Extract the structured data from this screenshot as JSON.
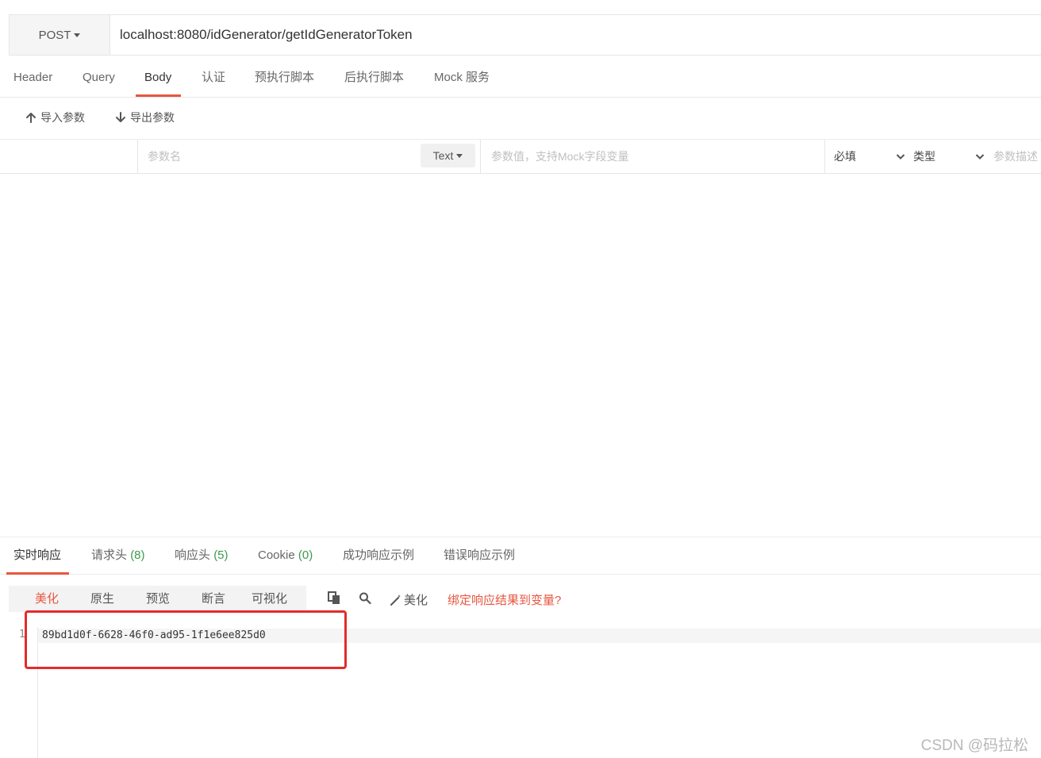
{
  "request": {
    "method": "POST",
    "url": "localhost:8080/idGenerator/getIdGeneratorToken"
  },
  "request_tabs": [
    "Header",
    "Query",
    "Body",
    "认证",
    "预执行脚本",
    "后执行脚本",
    "Mock 服务"
  ],
  "active_request_tab": "Body",
  "toolbar": {
    "import_label": "导入参数",
    "export_label": "导出参数"
  },
  "param_row": {
    "name_placeholder": "参数名",
    "type_select": "Text",
    "value_placeholder": "参数值，支持Mock字段变量",
    "required_label": "必填",
    "type_label": "类型",
    "desc_placeholder": "参数描述"
  },
  "response_tabs": [
    {
      "label": "实时响应",
      "count": ""
    },
    {
      "label": "请求头",
      "count": "(8)"
    },
    {
      "label": "响应头",
      "count": "(5)"
    },
    {
      "label": "Cookie",
      "count": "(0)"
    },
    {
      "label": "成功响应示例",
      "count": ""
    },
    {
      "label": "错误响应示例",
      "count": ""
    }
  ],
  "active_response_tab": "实时响应",
  "response_view_modes": [
    "美化",
    "原生",
    "预览",
    "断言",
    "可视化"
  ],
  "active_view_mode": "美化",
  "response_actions": {
    "copy_icon": "copy-icon",
    "search_icon": "search-icon",
    "beautify_label": "美化",
    "bind_link": "绑定响应结果到变量?"
  },
  "response_body": {
    "line_number": "1",
    "content": "89bd1d0f-6628-46f0-ad95-1f1e6ee825d0"
  },
  "watermark": "CSDN @码拉松",
  "colors": {
    "accent": "#e8563f",
    "count_green": "#3a9b4a",
    "highlight_red": "#e52b2b"
  }
}
